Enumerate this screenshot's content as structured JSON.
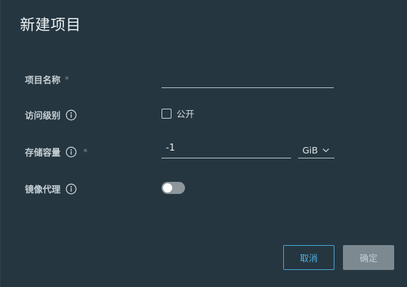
{
  "dialog": {
    "title": "新建项目"
  },
  "form": {
    "project_name": {
      "label": "项目名称",
      "required_mark": "*",
      "value": ""
    },
    "access_level": {
      "label": "访问级别",
      "info_icon": "info-icon",
      "option_label": "公开",
      "checked": false
    },
    "storage_quota": {
      "label": "存储容量",
      "info_icon": "info-icon",
      "required_mark": "*",
      "value": "-1",
      "unit": "GiB",
      "unit_icon": "chevron-down-icon"
    },
    "mirror_proxy": {
      "label": "镜像代理",
      "info_icon": "info-icon",
      "enabled": false
    }
  },
  "buttons": {
    "cancel_label": "取消",
    "ok_label": "确定"
  },
  "colors": {
    "background": "#253640",
    "accent": "#4aa8d6",
    "disabled_button": "#7d8990"
  }
}
